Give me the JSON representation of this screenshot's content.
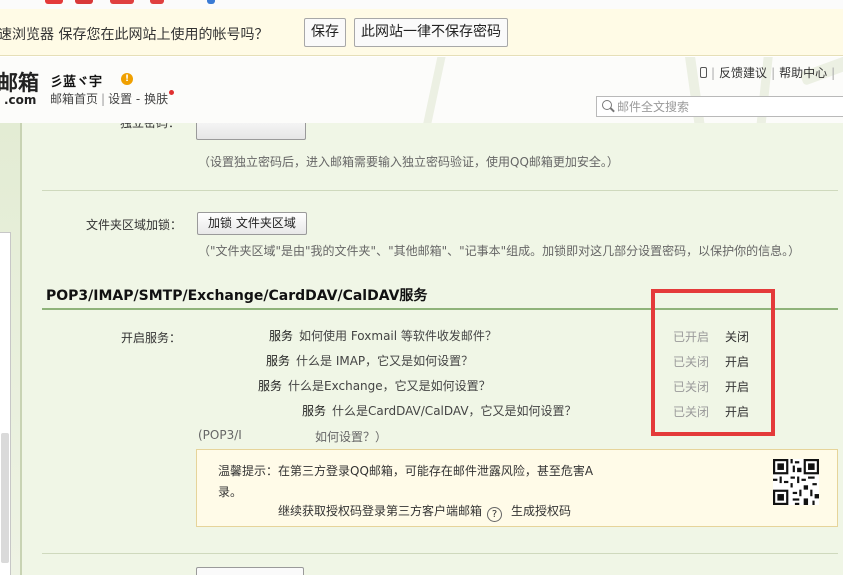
{
  "password_bar": {
    "message": "速浏览器 保存您在此网站上使用的帐号吗？",
    "save_button": "保存",
    "never_button": "此网站一律不保存密码"
  },
  "header": {
    "logo_main": "邮箱",
    "logo_sub": ".com",
    "username": "彡蓝ヾ宇",
    "warning_badge": "!",
    "nav": {
      "home": "邮箱首页",
      "settings": "设置",
      "dash": "-",
      "skin": "换肤"
    },
    "top_links": {
      "feedback": "反馈建议",
      "help": "帮助中心"
    },
    "search": {
      "placeholder": "邮件全文搜索"
    }
  },
  "settings": {
    "independent_password_hint": "（设置独立密码后，进入邮箱需要输入独立密码验证，使用QQ邮箱更加安全。）",
    "folder_area": {
      "label": "文件夹区域加锁：",
      "button": "加锁 文件夹区域",
      "hint": "（\"文件夹区域\"是由\"我的文件夹\"、\"其他邮箱\"、\"记事本\"组成。加锁即对这几部分设置密码，以保护你的信息。）"
    },
    "section_title": "POP3/IMAP/SMTP/Exchange/CardDAV/CalDAV服务",
    "enable_service_label": "开启服务：",
    "services": [
      {
        "name": "服务",
        "help_text": "如何使用 Foxmail 等软件收发邮件？",
        "status": "已开启",
        "action": "关闭"
      },
      {
        "name": "服务",
        "help_text": "什么是 IMAP，它又是如何设置？",
        "status": "已关闭",
        "action": "开启"
      },
      {
        "name": "服务",
        "help_text": "什么是Exchange，它又是如何设置？",
        "status": "已关闭",
        "action": "开启"
      },
      {
        "name": "服务",
        "help_text": "什么是CardDAV/CalDAV，它又是如何设置？",
        "status": "已关闭",
        "action": "开启"
      }
    ],
    "pop3_note_prefix": "(POP3/I",
    "pop3_note_suffix": "如何设置？）",
    "tip": {
      "line1": "温馨提示：在第三方登录QQ邮箱，可能存在邮件泄露风险，甚至危害A",
      "line2": "录。",
      "line3": "继续获取授权码登录第三方客户端邮箱",
      "help_mark": "?",
      "generate_link": "生成授权码"
    }
  },
  "colors": {
    "password_bar_bg": "#fffbe6",
    "content_bg": "#f0f6e6",
    "highlight_box": "#e43a3a",
    "section_rule": "#8fb37a",
    "warning_badge": "#f0a000"
  }
}
